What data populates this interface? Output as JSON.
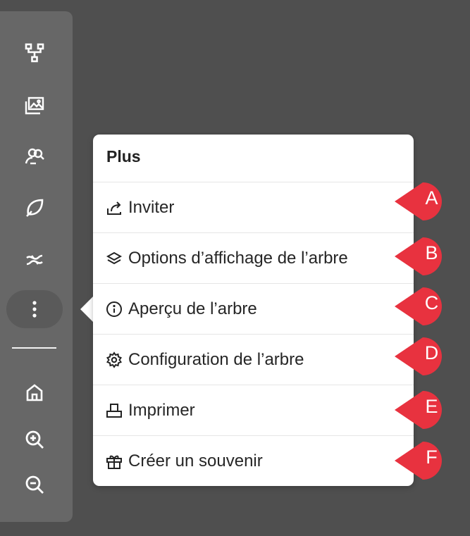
{
  "toolbar": {
    "items": [
      {
        "icon": "family-tree-icon"
      },
      {
        "icon": "photos-icon"
      },
      {
        "icon": "people-search-icon"
      },
      {
        "icon": "leaf-hint-icon"
      },
      {
        "icon": "dna-icon"
      },
      {
        "icon": "more-options-icon"
      },
      {
        "icon": "home-icon"
      },
      {
        "icon": "zoom-in-icon"
      },
      {
        "icon": "zoom-out-icon"
      }
    ]
  },
  "menu": {
    "title": "Plus",
    "items": [
      {
        "label": "Inviter",
        "icon": "share-icon",
        "marker": "A"
      },
      {
        "label": "Options d’affichage de l’arbre",
        "icon": "layers-icon",
        "marker": "B"
      },
      {
        "label": "Aperçu de l’arbre",
        "icon": "info-icon",
        "marker": "C"
      },
      {
        "label": "Configuration de l’arbre",
        "icon": "gear-icon",
        "marker": "D"
      },
      {
        "label": "Imprimer",
        "icon": "print-icon",
        "marker": "E"
      },
      {
        "label": "Créer un souvenir",
        "icon": "gift-icon",
        "marker": "F"
      }
    ]
  },
  "colors": {
    "background": "#4f4f4f",
    "toolbar": "#676767",
    "menu": "#ffffff",
    "callout": "#e8323f"
  }
}
